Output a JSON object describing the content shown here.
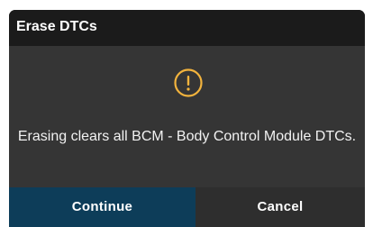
{
  "dialog": {
    "title": "Erase DTCs",
    "icon": "warning-circle-icon",
    "icon_color": "#f2b33d",
    "message": "Erasing clears all BCM - Body Control Module DTCs.",
    "continue_label": "Continue",
    "cancel_label": "Cancel",
    "accent_color": "#0d3d59"
  }
}
